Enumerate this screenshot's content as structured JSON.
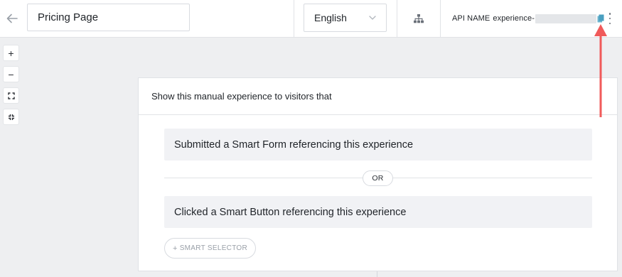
{
  "header": {
    "page_name_value": "Pricing Page",
    "language": "English",
    "api_label": "API NAME",
    "api_value_prefix": "experience-"
  },
  "zoom": {
    "zoom_in": "+",
    "zoom_out": "−"
  },
  "card": {
    "title": "Show this manual experience to visitors that",
    "rules": [
      "Submitted a Smart Form referencing this experience",
      "Clicked a Smart Button referencing this experience"
    ],
    "or_label": "OR",
    "smart_selector_plus": "+",
    "smart_selector_label": "SMART SELECTOR"
  },
  "colors": {
    "annotation_arrow": "#f05a5a",
    "copy_icon": "#4a9fc0",
    "background": "#eeeff1"
  },
  "icons": [
    "back-arrow-icon",
    "chevron-down-icon",
    "sitemap-icon",
    "copy-icon",
    "kebab-menu-icon",
    "fit-screen-icon",
    "collapse-icon"
  ]
}
